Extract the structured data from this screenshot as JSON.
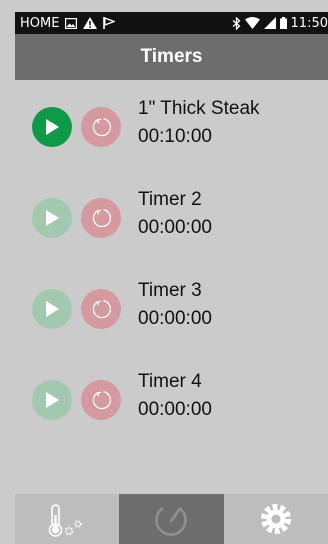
{
  "status_bar": {
    "home_label": "HOME",
    "time": "11:50",
    "icons": [
      "image-icon",
      "warning-icon",
      "flag-icon",
      "bluetooth-icon",
      "wifi-icon",
      "signal-icon",
      "battery-icon"
    ]
  },
  "app_bar": {
    "title": "Timers"
  },
  "timers": [
    {
      "name": "1\" Thick Steak",
      "time": "00:10:00",
      "active": true
    },
    {
      "name": "Timer 2",
      "time": "00:00:00",
      "active": false
    },
    {
      "name": "Timer 3",
      "time": "00:00:00",
      "active": false
    },
    {
      "name": "Timer 4",
      "time": "00:00:00",
      "active": false
    }
  ],
  "bottom_nav": {
    "tabs": [
      {
        "icon": "thermometer-settings-icon",
        "selected": false
      },
      {
        "icon": "timer-gauge-icon",
        "selected": true
      },
      {
        "icon": "gear-icon",
        "selected": false
      }
    ]
  },
  "colors": {
    "background": "#cbcbcb",
    "app_bar": "#6d6d6d",
    "play_active": "#0f9a48",
    "play_inactive": "#a3c8b0",
    "reset": "#d49a9f"
  }
}
